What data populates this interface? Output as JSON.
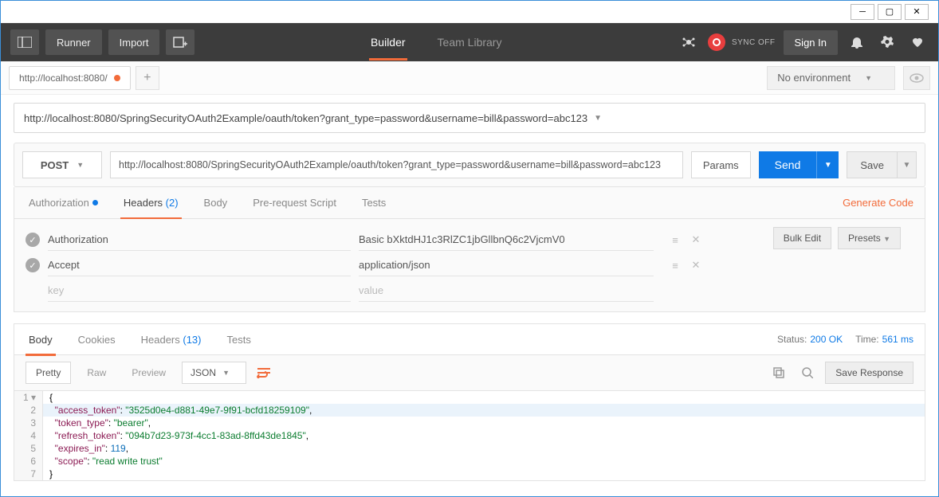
{
  "window": {
    "minimize": "─",
    "maximize": "▢",
    "close": "✕"
  },
  "topbar": {
    "runner": "Runner",
    "import": "Import",
    "tabs": {
      "builder": "Builder",
      "team_library": "Team Library"
    },
    "sync": "SYNC OFF",
    "signin": "Sign In"
  },
  "env": {
    "tab_label": "http://localhost:8080/",
    "no_env": "No environment"
  },
  "request": {
    "display_url": "http://localhost:8080/SpringSecurityOAuth2Example/oauth/token?grant_type=password&username=bill&password=abc123",
    "method": "POST",
    "url": "http://localhost:8080/SpringSecurityOAuth2Example/oauth/token?grant_type=password&username=bill&password=abc123",
    "params": "Params",
    "send": "Send",
    "save": "Save"
  },
  "req_tabs": {
    "authorization": "Authorization",
    "headers": "Headers",
    "headers_count": "(2)",
    "body": "Body",
    "prerequest": "Pre-request Script",
    "tests": "Tests",
    "generate": "Generate Code"
  },
  "headers": [
    {
      "key": "Authorization",
      "value": "Basic bXktdHJ1c3RlZC1jbGllbnQ6c2VjcmV0"
    },
    {
      "key": "Accept",
      "value": "application/json"
    }
  ],
  "header_placeholder": {
    "key": "key",
    "value": "value"
  },
  "header_buttons": {
    "bulk": "Bulk Edit",
    "presets": "Presets"
  },
  "resp_tabs": {
    "body": "Body",
    "cookies": "Cookies",
    "headers": "Headers",
    "headers_count": "(13)",
    "tests": "Tests"
  },
  "response": {
    "status_label": "Status:",
    "status_value": "200 OK",
    "time_label": "Time:",
    "time_value": "561 ms",
    "pretty": "Pretty",
    "raw": "Raw",
    "preview": "Preview",
    "format": "JSON",
    "save_response": "Save Response"
  },
  "body": {
    "access_token": "3525d0e4-d881-49e7-9f91-bcfd18259109",
    "token_type": "bearer",
    "refresh_token": "094b7d23-973f-4cc1-83ad-8ffd43de1845",
    "expires_in": 119,
    "scope": "read write trust"
  }
}
